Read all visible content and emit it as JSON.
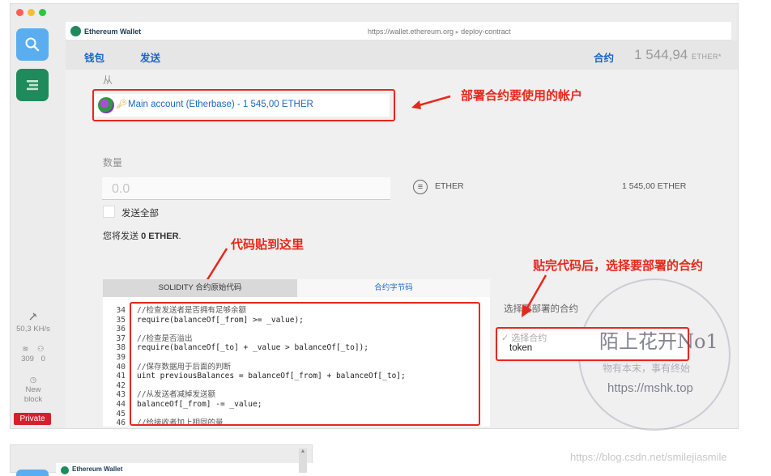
{
  "window": {
    "url_host": "https://wallet.ethereum.org",
    "url_path": "deploy-contract",
    "app_brand": "Ethereum Wallet"
  },
  "sidebar": {
    "hashrate": "50,3 KH/s",
    "peers_count": "309",
    "peers_other": "0",
    "new_block_label": "New block",
    "private_label": "Private"
  },
  "nav": {
    "wallets": "钱包",
    "send": "发送",
    "contracts": "合约",
    "balance_value": "1 544,94",
    "balance_unit": "ETHER*"
  },
  "form": {
    "from_label": "从",
    "account_text": "Main account (Etherbase) - 1 545,00 ETHER",
    "amount_label": "数量",
    "amount_placeholder": "0.0",
    "currency": "ETHER",
    "available": "1 545,00 ETHER",
    "send_all_label": "发送全部",
    "summary_prefix": "您将发送",
    "summary_amount": "0 ETHER",
    "summary_suffix": "."
  },
  "code_tabs": {
    "source": "SOLIDITY 合约原始代码",
    "bytecode": "合约字节码"
  },
  "code_lines": [
    {
      "n": "34",
      "t": "//检查发送者是否拥有足够余额"
    },
    {
      "n": "35",
      "t": "require(balanceOf[_from] >= _value);"
    },
    {
      "n": "36",
      "t": ""
    },
    {
      "n": "37",
      "t": "//检查是否溢出"
    },
    {
      "n": "38",
      "t": "require(balanceOf[_to] + _value > balanceOf[_to]);"
    },
    {
      "n": "39",
      "t": ""
    },
    {
      "n": "40",
      "t": "//保存数据用于后面的判断"
    },
    {
      "n": "41",
      "t": "uint previousBalances = balanceOf[_from] + balanceOf[_to];"
    },
    {
      "n": "42",
      "t": ""
    },
    {
      "n": "43",
      "t": "//从发送者减掉发送额"
    },
    {
      "n": "44",
      "t": "balanceOf[_from] -= _value;"
    },
    {
      "n": "45",
      "t": ""
    },
    {
      "n": "46",
      "t": "//给接收者加上相同的量"
    }
  ],
  "contract_select": {
    "label": "选择要部署的合约",
    "options": [
      "选择合约",
      "token"
    ],
    "check": "✓"
  },
  "annotations": {
    "account": "部署合约要使用的帐户",
    "paste": "代码贴到这里",
    "choose": "贴完代码后，选择要部署的合约"
  },
  "watermark": {
    "title": "陌上花开No1",
    "subtitle": "物有本末，事有终始",
    "url": "https://mshk.top"
  },
  "second_window": {
    "brand": "Ethereum Wallet"
  },
  "footer_watermark": "https://blog.csdn.net/smilejiasmile",
  "colors": {
    "accent_blue": "#1a67c5",
    "annotation_red": "#e8271b",
    "private_red": "#d4202d",
    "sidebar_search": "#5aaef0",
    "sidebar_green": "#1f8a5c"
  }
}
